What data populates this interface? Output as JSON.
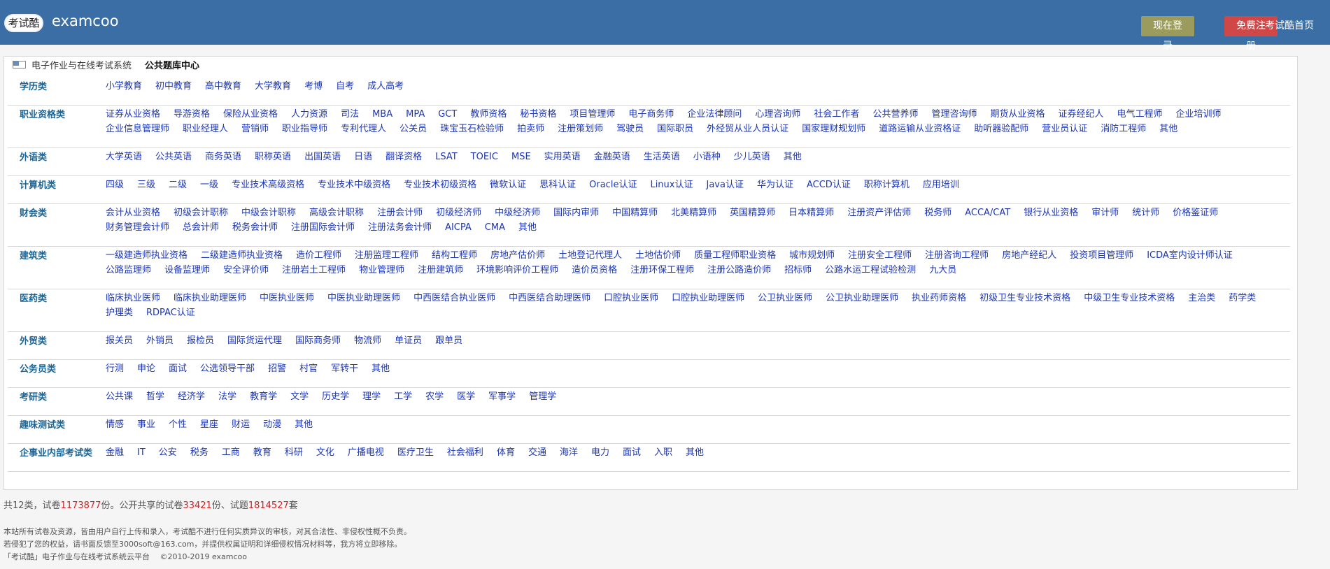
{
  "header": {
    "logo_seal": "考试酷",
    "brand": "examcoo",
    "login": "现在登录",
    "register": "免费注册",
    "home": "考试酷首页"
  },
  "panel": {
    "system": "电子作业与在线考试系统",
    "center": "公共题库中心"
  },
  "categories": [
    {
      "name": "学历类",
      "items": [
        "小学教育",
        "初中教育",
        "高中教育",
        "大学教育",
        "考博",
        "自考",
        "成人高考"
      ]
    },
    {
      "name": "职业资格类",
      "items": [
        "证券从业资格",
        "导游资格",
        "保险从业资格",
        "人力资源",
        "司法",
        "MBA",
        "MPA",
        "GCT",
        "教师资格",
        "秘书资格",
        "项目管理师",
        "电子商务师",
        "企业法律顾问",
        "心理咨询师",
        "社会工作者",
        "公共营养师",
        "管理咨询师",
        "期货从业资格",
        "证券经纪人",
        "电气工程师",
        "企业培训师",
        "企业信息管理师",
        "职业经理人",
        "营销师",
        "职业指导师",
        "专利代理人",
        "公关员",
        "珠宝玉石检验师",
        "拍卖师",
        "注册策划师",
        "驾驶员",
        "国际职员",
        "外经贸从业人员认证",
        "国家理财规划师",
        "道路运输从业资格证",
        "助听器验配师",
        "营业员认证",
        "消防工程师",
        "其他"
      ]
    },
    {
      "name": "外语类",
      "items": [
        "大学英语",
        "公共英语",
        "商务英语",
        "职称英语",
        "出国英语",
        "日语",
        "翻译资格",
        "LSAT",
        "TOEIC",
        "MSE",
        "实用英语",
        "金融英语",
        "生活英语",
        "小语种",
        "少儿英语",
        "其他"
      ]
    },
    {
      "name": "计算机类",
      "items": [
        "四级",
        "三级",
        "二级",
        "一级",
        "专业技术高级资格",
        "专业技术中级资格",
        "专业技术初级资格",
        "微软认证",
        "思科认证",
        "Oracle认证",
        "Linux认证",
        "Java认证",
        "华为认证",
        "ACCD认证",
        "职称计算机",
        "应用培训"
      ]
    },
    {
      "name": "财会类",
      "items": [
        "会计从业资格",
        "初级会计职称",
        "中级会计职称",
        "高级会计职称",
        "注册会计师",
        "初级经济师",
        "中级经济师",
        "国际内审师",
        "中国精算师",
        "北美精算师",
        "英国精算师",
        "日本精算师",
        "注册资产评估师",
        "税务师",
        "ACCA/CAT",
        "银行从业资格",
        "审计师",
        "统计师",
        "价格鉴证师",
        "财务管理会计师",
        "总会计师",
        "税务会计师",
        "注册国际会计师",
        "注册法务会计师",
        "AICPA",
        "CMA",
        "其他"
      ]
    },
    {
      "name": "建筑类",
      "items": [
        "一级建造师执业资格",
        "二级建造师执业资格",
        "造价工程师",
        "注册监理工程师",
        "结构工程师",
        "房地产估价师",
        "土地登记代理人",
        "土地估价师",
        "质量工程师职业资格",
        "城市规划师",
        "注册安全工程师",
        "注册咨询工程师",
        "房地产经纪人",
        "投资项目管理师",
        "ICDA室内设计师认证",
        "公路监理师",
        "设备监理师",
        "安全评价师",
        "注册岩土工程师",
        "物业管理师",
        "注册建筑师",
        "环境影响评价工程师",
        "造价员资格",
        "注册环保工程师",
        "注册公路造价师",
        "招标师",
        "公路水运工程试验检测",
        "九大员"
      ]
    },
    {
      "name": "医药类",
      "items": [
        "临床执业医师",
        "临床执业助理医师",
        "中医执业医师",
        "中医执业助理医师",
        "中西医结合执业医师",
        "中西医结合助理医师",
        "口腔执业医师",
        "口腔执业助理医师",
        "公卫执业医师",
        "公卫执业助理医师",
        "执业药师资格",
        "初级卫生专业技术资格",
        "中级卫生专业技术资格",
        "主治类",
        "药学类",
        "护理类",
        "RDPAC认证"
      ]
    },
    {
      "name": "外贸类",
      "items": [
        "报关员",
        "外销员",
        "报检员",
        "国际货运代理",
        "国际商务师",
        "物流师",
        "单证员",
        "跟单员"
      ]
    },
    {
      "name": "公务员类",
      "items": [
        "行测",
        "申论",
        "面试",
        "公选领导干部",
        "招警",
        "村官",
        "军转干",
        "其他"
      ]
    },
    {
      "name": "考研类",
      "items": [
        "公共课",
        "哲学",
        "经济学",
        "法学",
        "教育学",
        "文学",
        "历史学",
        "理学",
        "工学",
        "农学",
        "医学",
        "军事学",
        "管理学"
      ]
    },
    {
      "name": "趣味测试类",
      "items": [
        "情感",
        "事业",
        "个性",
        "星座",
        "财运",
        "动漫",
        "其他"
      ]
    },
    {
      "name": "企事业内部考试类",
      "items": [
        "金融",
        "IT",
        "公安",
        "税务",
        "工商",
        "教育",
        "科研",
        "文化",
        "广播电视",
        "医疗卫生",
        "社会福利",
        "体育",
        "交通",
        "海洋",
        "电力",
        "面试",
        "入职",
        "其他"
      ]
    }
  ],
  "summary": {
    "prefix": "共12类，试卷",
    "papers": "1173877",
    "mid1": "份。公开共享的试卷",
    "shared": "33421",
    "mid2": "份、试题",
    "questions": "1814527",
    "suffix": "套"
  },
  "footer": {
    "line1": "本站所有试卷及资源，皆由用户自行上传和录入，考试酷不进行任何实质异议的审核，对其合法性、非侵权性概不负责。",
    "line2": "若侵犯了您的权益，请书面反馈至3000soft@163.com，并提供权属证明和详细侵权情况材料等，我方将立即移除。",
    "line3": "「考试酷」电子作业与在线考试系统云平台　 ©2010-2019 examcoo"
  }
}
